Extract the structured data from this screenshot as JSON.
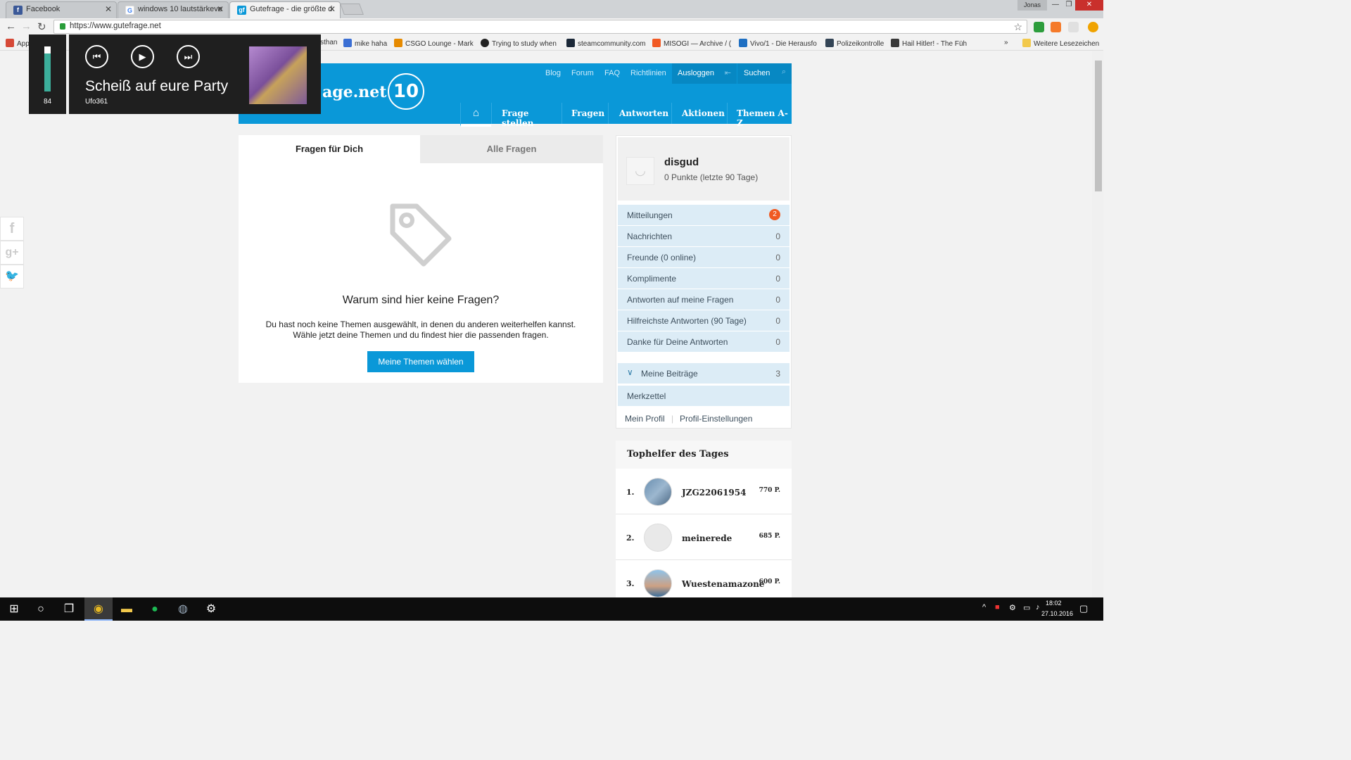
{
  "browser": {
    "tabs": [
      {
        "title": "Facebook"
      },
      {
        "title": "windows 10 lautstärkeve"
      },
      {
        "title": "Gutefrage - die größte d"
      }
    ],
    "profile_name": "Jonas",
    "url": "https://www.gutefrage.net",
    "bookmarks": [
      {
        "label": "App"
      },
      {
        "label": "sthan"
      },
      {
        "label": "mike haha"
      },
      {
        "label": "CSGO Lounge - Mark"
      },
      {
        "label": "Trying to study when"
      },
      {
        "label": "steamcommunity.com"
      },
      {
        "label": "MISOGI — Archive / ("
      },
      {
        "label": "Vivo/1 - Die Herausfo"
      },
      {
        "label": "Polizeikontrolle"
      },
      {
        "label": "Hail Hitler! - The Füh"
      }
    ],
    "more_bookmarks": "Weitere Lesezeichen"
  },
  "header": {
    "logo_text": "age.net",
    "anniversary": "10",
    "top_links": [
      "Blog",
      "Forum",
      "FAQ",
      "Richtlinien"
    ],
    "logout": "Ausloggen",
    "search": "Suchen",
    "nav": [
      "Frage stellen",
      "Fragen",
      "Antworten",
      "Aktionen",
      "Themen A-Z"
    ]
  },
  "main": {
    "tabs": [
      "Fragen für Dich",
      "Alle Fragen"
    ],
    "empty_title": "Warum sind hier keine Fragen?",
    "empty_text_line1": "Du hast noch keine Themen ausgewählt, in denen du anderen weiterhelfen kannst.",
    "empty_text_line2": "Wähle jetzt deine Themen und du findest hier die passenden fragen.",
    "choose_button": "Meine Themen wählen"
  },
  "sidebar": {
    "username": "disgud",
    "points": "0 Punkte (letzte 90 Tage)",
    "rows": [
      {
        "label": "Mitteilungen",
        "value": "2"
      },
      {
        "label": "Nachrichten",
        "value": "0"
      },
      {
        "label": "Freunde (0 online)",
        "value": "0"
      },
      {
        "label": "Komplimente",
        "value": "0"
      },
      {
        "label": "Antworten auf meine Fragen",
        "value": "0"
      },
      {
        "label": "Hilfreichste Antworten (90 Tage)",
        "value": "0"
      },
      {
        "label": "Danke für Deine Antworten",
        "value": "0"
      }
    ],
    "my_posts": {
      "label": "Meine Beiträge",
      "value": "3"
    },
    "watchlist": "Merkzettel",
    "profile_link": "Mein Profil",
    "settings_link": "Profil-Einstellungen"
  },
  "tophelfer": {
    "title": "Tophelfer des Tages",
    "entries": [
      {
        "rank": "1.",
        "name": "JZG22061954",
        "points": "770 P."
      },
      {
        "rank": "2.",
        "name": "meinerede",
        "points": "685 P."
      },
      {
        "rank": "3.",
        "name": "Wuestenamazone",
        "points": "600 P."
      }
    ]
  },
  "media": {
    "volume": "84",
    "volume_fraction": 0.84,
    "song": "Scheiß auf eure Party",
    "artist": "Ufo361"
  },
  "taskbar": {
    "time": "18:02",
    "date": "27.10.2016"
  }
}
